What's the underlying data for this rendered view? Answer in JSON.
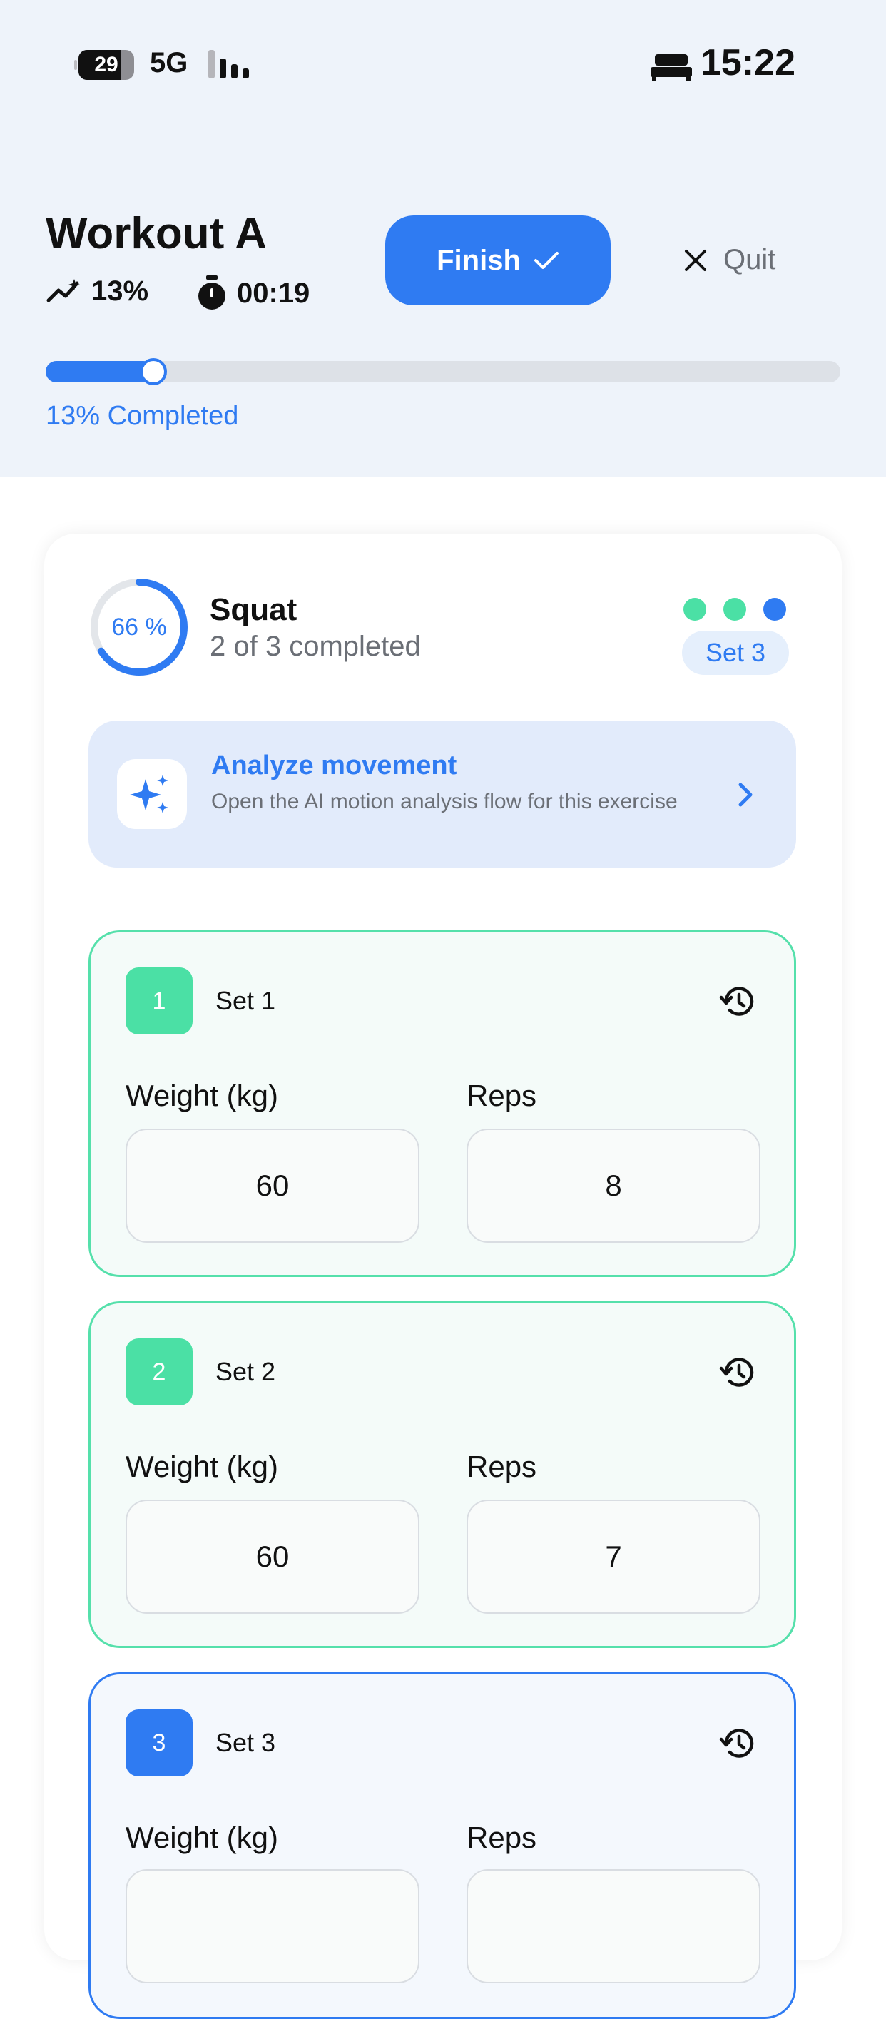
{
  "status_bar": {
    "battery": "29",
    "network": "5G",
    "time": "15:22"
  },
  "header": {
    "title": "Workout A",
    "progress_stat": "13%",
    "timer": "00:19",
    "finish_label": "Finish",
    "quit_label": "Quit",
    "progress_fraction": 0.13,
    "progress_label": "13% Completed"
  },
  "exercise": {
    "ring_label": "66 %",
    "ring_fraction": 0.66,
    "name": "Squat",
    "subtitle": "2 of 3 completed",
    "current_set": "Set 3",
    "set_dot_colors": [
      "#4be0a5",
      "#4be0a5",
      "#2f7bf2"
    ]
  },
  "analyze": {
    "title": "Analyze movement",
    "description": "Open the AI motion analysis flow for this exercise"
  },
  "sets": [
    {
      "number": "1",
      "title": "Set 1",
      "weight_label": "Weight (kg)",
      "reps_label": "Reps",
      "weight": "60",
      "reps": "8"
    },
    {
      "number": "2",
      "title": "Set 2",
      "weight_label": "Weight (kg)",
      "reps_label": "Reps",
      "weight": "60",
      "reps": "7"
    },
    {
      "number": "3",
      "title": "Set 3",
      "weight_label": "Weight (kg)",
      "reps_label": "Reps"
    }
  ],
  "colors": {
    "accent": "#2f7bf2",
    "done": "#4be0a5",
    "header_bg": "#eef3fa"
  }
}
